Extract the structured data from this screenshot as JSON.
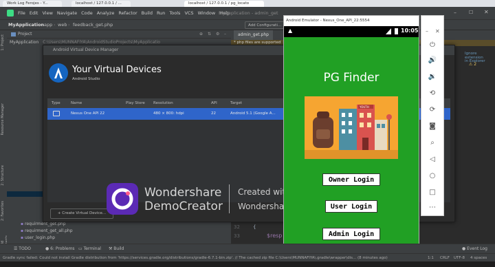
{
  "browser": {
    "tabs": [
      "Work Log Ferojes - Y...",
      "localhost / 127.0.0.1 / ...",
      "localhost / 127.0.0.1 / pg_locato"
    ]
  },
  "ide": {
    "menu": [
      "File",
      "Edit",
      "View",
      "Navigate",
      "Code",
      "Analyze",
      "Refactor",
      "Build",
      "Run",
      "Tools",
      "VCS",
      "Window",
      "Help"
    ],
    "window_title": "MyApplication - admin_get",
    "breadcrumb": [
      "MyApplication",
      "app",
      "web",
      "feedback_get.php"
    ],
    "add_config": "Add Configurati...",
    "project_label": "Project",
    "project_root": "MyApplication",
    "project_root_path": "C:\\Users\\MUNNAFIYA\\AndroidStudioProjects\\MyApplicatio",
    "editor_tab": "admin_get.php",
    "editor_notice": "* php files are supported",
    "side_links": [
      "Ignore extension",
      "in Explorer"
    ],
    "warning_count": "2",
    "left_strip": [
      "1: Project",
      "Resource Manager",
      "2: Structure",
      "2: Favorites",
      "Build Variants"
    ],
    "tree_files": [
      "requirment_get.php",
      "requirment_get_all.php",
      "user_login.php"
    ],
    "code_lines": [
      {
        "num": "32",
        "text": "{"
      },
      {
        "num": "33",
        "text": "$resp"
      }
    ],
    "bottom_tools": [
      "TODO",
      "6: Problems",
      "Terminal",
      "Build"
    ],
    "event_log": "Event Log",
    "status_message": "Gradle sync failed: Could not install Gradle distribution from 'https://services.gradle.org/distributions/gradle-6.7.1-bin.zip'. // The cached zip file C:\\Users\\MUNNAFIYA\\.gradle\\wrapper\\dis... (8 minutes ago)",
    "status_right": [
      "1:1",
      "CRLF",
      "UTF-8",
      "4 spaces"
    ]
  },
  "avd": {
    "window_title": "Android Virtual Device Manager",
    "heading": "Your Virtual Devices",
    "subheading": "Android Studio",
    "columns": [
      "Type",
      "Name",
      "Play Store",
      "Resolution",
      "API",
      "Target"
    ],
    "device": {
      "name": "Nexus One API 22",
      "play_store": "",
      "resolution": "480 × 800: hdpi",
      "api": "22",
      "target": "Android 5.1 (Google A..."
    },
    "create_button": "+ Create Virtual Device..."
  },
  "watermark": {
    "brand_line1": "Wondershare",
    "brand_line2": "DemoCreator",
    "text_line1": "Created with",
    "text_line2": "Wondershare DemoCreator Plan"
  },
  "emulator": {
    "window_title": "Android Emulator - Nexus_One_API_22:5554",
    "time": "10:05",
    "app_title": "PG Finder",
    "image_sign": "YOUTH",
    "buttons": {
      "owner": "Owner Login",
      "user": "User Login",
      "admin": "Admin Login"
    },
    "tools": [
      "power-icon",
      "volume-up-icon",
      "volume-down-icon",
      "rotate-left-icon",
      "rotate-right-icon",
      "camera-icon",
      "zoom-icon",
      "back-icon",
      "home-icon",
      "overview-icon",
      "more-icon"
    ]
  },
  "colors": {
    "app_bg": "#21a024",
    "avd_selected_row": "#2f65ca",
    "ide_bg": "#2b2b2b",
    "ide_panel": "#3c3f41"
  }
}
